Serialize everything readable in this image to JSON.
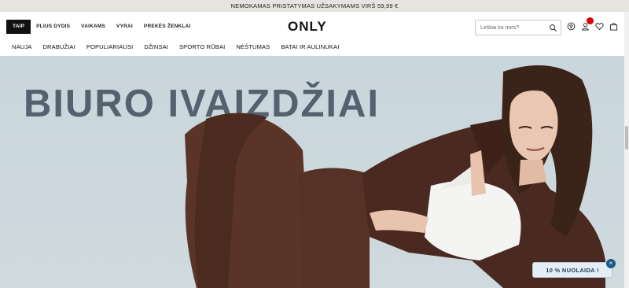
{
  "promo": {
    "text": "NEMOKAMAS PRISTATYMAS UŽSAKYMAMS VIRŠ 59,99 €"
  },
  "brand_tabs": [
    {
      "label": "TAIP"
    },
    {
      "label": "PLIUS DYDIS"
    },
    {
      "label": "VAIKAMS"
    },
    {
      "label": "VYRAI"
    },
    {
      "label": "PREKĖS ŽENKLAI"
    }
  ],
  "logo": {
    "text": "ONLY"
  },
  "search": {
    "placeholder": "Leškai ko nors?"
  },
  "header_icons": [
    "store-locator-icon",
    "account-icon",
    "wishlist-heart-icon",
    "shopping-bag-icon"
  ],
  "categories": [
    {
      "label": "NAUJA"
    },
    {
      "label": "DRABUŽIAI"
    },
    {
      "label": "POPULIARIAUSI"
    },
    {
      "label": "DŽINSAI"
    },
    {
      "label": "SPORTO RŪBAI"
    },
    {
      "label": "NĖŠTUMAS"
    },
    {
      "label": "BATAI IR AULINUKAI"
    }
  ],
  "hero": {
    "title": "BIURO IVAIZDŽIAI"
  },
  "discount": {
    "label": "10 % NUOLAIDA !",
    "close": "×"
  },
  "colors": {
    "promo_bg": "#e6e4df",
    "hero_bg": "#c9d6db",
    "hero_title": "#55616f",
    "badge": "#e00000",
    "discount_close": "#1f5a8c"
  }
}
